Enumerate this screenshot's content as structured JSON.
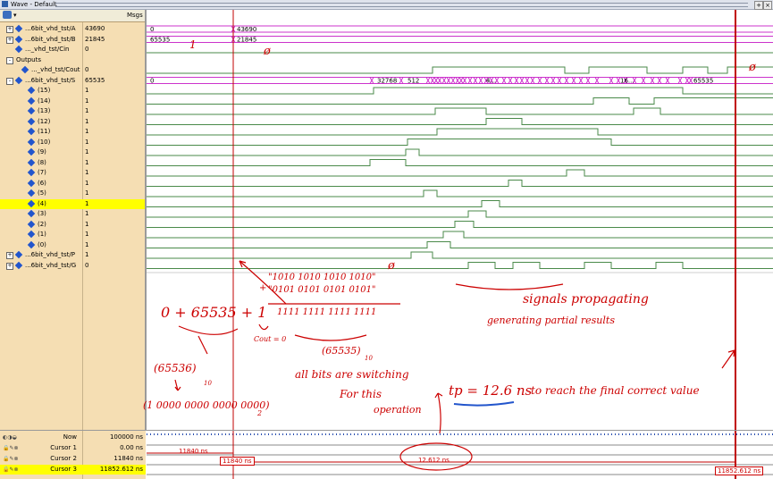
{
  "window": {
    "title": "Wave - Default"
  },
  "header": {
    "msgs_label": "Msgs"
  },
  "signals": [
    {
      "name": "...6bit_vhd_tst/A",
      "value": "43690",
      "expand": "+",
      "sel": false,
      "indent": 0
    },
    {
      "name": "...6bit_vhd_tst/B",
      "value": "21845",
      "expand": "+",
      "sel": false,
      "indent": 0
    },
    {
      "name": "..._vhd_tst/Cin",
      "value": "0",
      "expand": "",
      "sel": false,
      "indent": 0
    },
    {
      "name": "Outputs",
      "value": "",
      "expand": "-",
      "sel": false,
      "indent": 0,
      "group": true
    },
    {
      "name": "..._vhd_tst/Cout",
      "value": "0",
      "expand": "",
      "sel": false,
      "indent": 1
    },
    {
      "name": "...6bit_vhd_tst/S",
      "value": "65535",
      "expand": "-",
      "sel": false,
      "indent": 0
    },
    {
      "name": "(15)",
      "value": "1",
      "expand": "",
      "sel": false,
      "indent": 2
    },
    {
      "name": "(14)",
      "value": "1",
      "expand": "",
      "sel": false,
      "indent": 2
    },
    {
      "name": "(13)",
      "value": "1",
      "expand": "",
      "sel": false,
      "indent": 2
    },
    {
      "name": "(12)",
      "value": "1",
      "expand": "",
      "sel": false,
      "indent": 2
    },
    {
      "name": "(11)",
      "value": "1",
      "expand": "",
      "sel": false,
      "indent": 2
    },
    {
      "name": "(10)",
      "value": "1",
      "expand": "",
      "sel": false,
      "indent": 2
    },
    {
      "name": "(9)",
      "value": "1",
      "expand": "",
      "sel": false,
      "indent": 2
    },
    {
      "name": "(8)",
      "value": "1",
      "expand": "",
      "sel": false,
      "indent": 2
    },
    {
      "name": "(7)",
      "value": "1",
      "expand": "",
      "sel": false,
      "indent": 2
    },
    {
      "name": "(6)",
      "value": "1",
      "expand": "",
      "sel": false,
      "indent": 2
    },
    {
      "name": "(5)",
      "value": "1",
      "expand": "",
      "sel": false,
      "indent": 2
    },
    {
      "name": "(4)",
      "value": "1",
      "expand": "",
      "sel": true,
      "indent": 2
    },
    {
      "name": "(3)",
      "value": "1",
      "expand": "",
      "sel": false,
      "indent": 2
    },
    {
      "name": "(2)",
      "value": "1",
      "expand": "",
      "sel": false,
      "indent": 2
    },
    {
      "name": "(1)",
      "value": "1",
      "expand": "",
      "sel": false,
      "indent": 2
    },
    {
      "name": "(0)",
      "value": "1",
      "expand": "",
      "sel": false,
      "indent": 2
    },
    {
      "name": "...6bit_vhd_tst/P",
      "value": "1",
      "expand": "+",
      "sel": false,
      "indent": 0
    },
    {
      "name": "...6bit_vhd_tst/G",
      "value": "0",
      "expand": "+",
      "sel": false,
      "indent": 0
    }
  ],
  "bus_labels": {
    "a_before": "0",
    "a_after": "43690",
    "b_before": "65535",
    "b_after": "21845",
    "s_before": "0",
    "s_mid1": "32768",
    "s_mid2": "512",
    "s_mid3": "4...",
    "s_mid4": "16...",
    "s_final": "65535"
  },
  "cursors": [
    {
      "name": "Now",
      "value": "100000 ns",
      "sel": false
    },
    {
      "name": "Cursor 1",
      "value": "0.00 ns",
      "sel": false
    },
    {
      "name": "Cursor 2",
      "value": "11840 ns",
      "sel": false
    },
    {
      "name": "Cursor 3",
      "value": "11852.612 ns",
      "sel": true
    }
  ],
  "cursor_labels": {
    "delta1": "11840 ns",
    "c2": "11840 ns",
    "delta2": "12.612 ns",
    "c3": "11852.612 ns"
  },
  "annotations": {
    "zero_cin": "ø",
    "zero_cout": "ø",
    "one_label": "1",
    "a_bits": "\"1010 1010 1010 1010\"",
    "b_bits": "\"0101 0101 0101 0101\"",
    "plus": "+",
    "sum_bits": "1111 1111 1111 1111",
    "zero_top": "ø",
    "cout_note": "Cout = 0",
    "eq_sum": "0 + 65535 + 1",
    "dec_65535": "(65535)",
    "dec_sub10a": "10",
    "dec_65536": "(65536)",
    "dec_sub10b": "10",
    "bin_65536": "(1 0000 0000 0000 0000)",
    "bin_sub2": "2",
    "all_bits": "all bits are switching",
    "for_this": "For this",
    "operation": "operation",
    "signals_prop": "signals propagating",
    "gen_partial": "generating partial results",
    "tp": "tp = 12.6 ns",
    "final_note": "to reach the final correct value"
  },
  "colors": {
    "wave": "#4a8a4a",
    "bus": "#cc33cc",
    "cursor": "#c00000",
    "panel": "#f5deb3",
    "selected": "#ffff00"
  }
}
